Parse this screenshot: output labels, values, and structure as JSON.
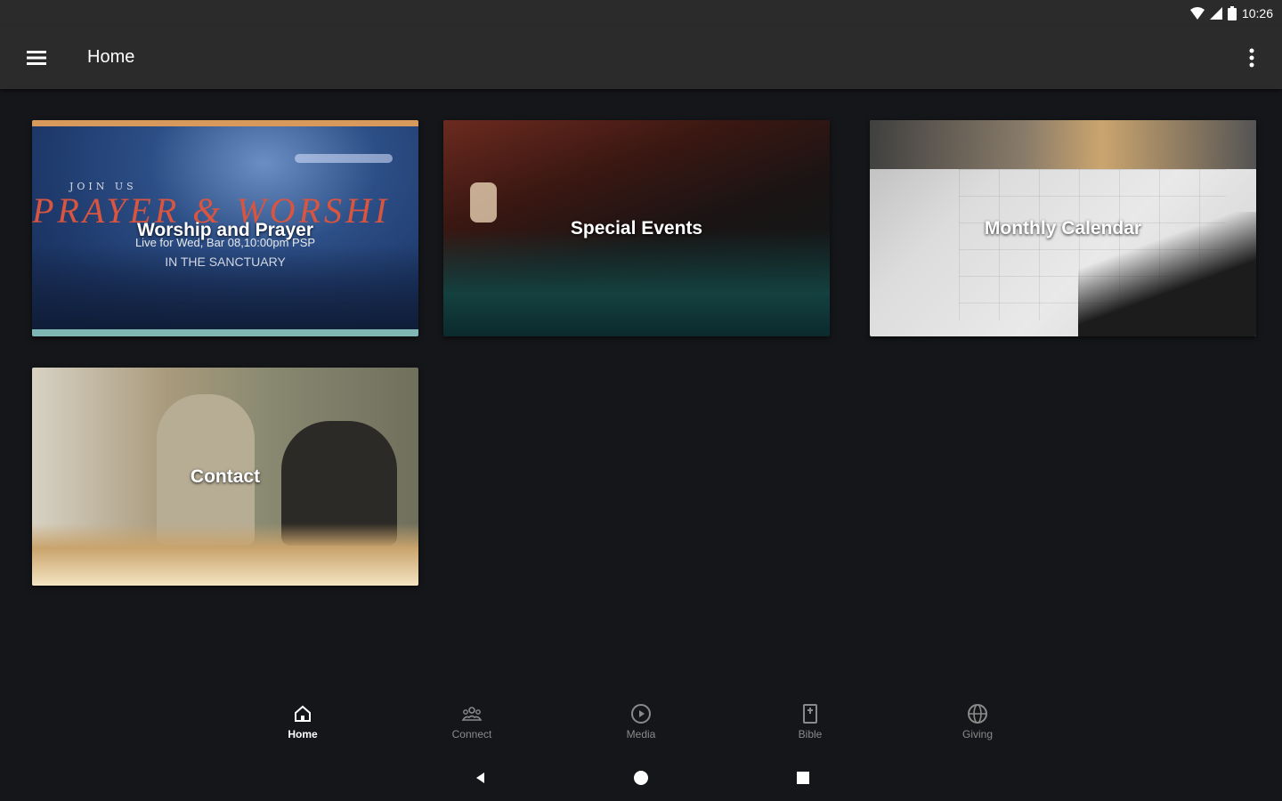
{
  "status_bar": {
    "time": "10:26",
    "icons": [
      "wifi-icon",
      "cell-signal-icon",
      "battery-icon"
    ]
  },
  "app_bar": {
    "title": "Home",
    "menu_icon": "hamburger-menu-icon",
    "overflow_icon": "more-vertical-icon"
  },
  "tiles": [
    {
      "label": "Worship and Prayer",
      "image_text": {
        "small": "JOIN US",
        "big": "PRAYER & WORSHI",
        "line1": "Live for Wed, Bar 08,10:00pm PSP",
        "line2": "IN THE SANCTUARY"
      }
    },
    {
      "label": "Special Events"
    },
    {
      "label": "Monthly Calendar"
    },
    {
      "label": "Contact"
    }
  ],
  "bottom_nav": {
    "items": [
      {
        "label": "Home",
        "icon": "home-icon",
        "active": true
      },
      {
        "label": "Connect",
        "icon": "group-icon",
        "active": false
      },
      {
        "label": "Media",
        "icon": "play-circle-icon",
        "active": false
      },
      {
        "label": "Bible",
        "icon": "book-icon",
        "active": false
      },
      {
        "label": "Giving",
        "icon": "globe-icon",
        "active": false
      }
    ]
  },
  "system_nav": [
    "back-icon",
    "home-circle-icon",
    "recents-square-icon"
  ],
  "colors": {
    "background": "#151619",
    "app_bar": "#2b2b2b",
    "active_nav": "#ffffff",
    "inactive_nav": "#8a8a8a"
  }
}
